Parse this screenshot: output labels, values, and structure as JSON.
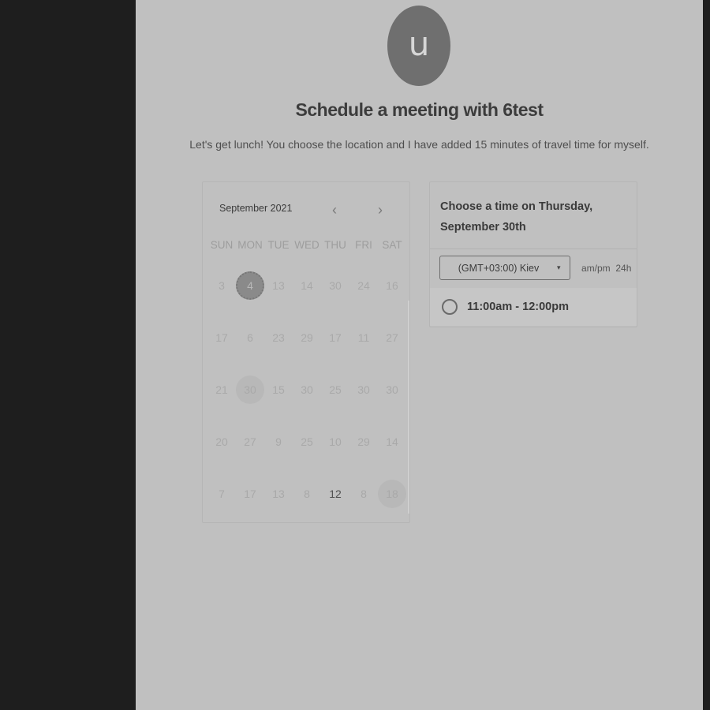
{
  "profile": {
    "avatar_letter": "u"
  },
  "page": {
    "title": "Schedule a meeting with 6test",
    "description": "Let's get lunch! You choose the location and I have added 15 minutes of travel time for myself."
  },
  "calendar": {
    "month_label": "September 2021",
    "prev_icon": "‹",
    "next_icon": "›",
    "weekdays": [
      "SUN",
      "MON",
      "TUE",
      "WED",
      "THU",
      "FRI",
      "SAT"
    ],
    "weeks": [
      [
        "3",
        "4",
        "13",
        "14",
        "30",
        "24",
        "16"
      ],
      [
        "17",
        "6",
        "23",
        "29",
        "17",
        "11",
        "27"
      ],
      [
        "21",
        "30",
        "15",
        "30",
        "25",
        "30",
        "30"
      ],
      [
        "20",
        "27",
        "9",
        "25",
        "10",
        "29",
        "14"
      ],
      [
        "7",
        "17",
        "13",
        "8",
        "12",
        "8",
        "18"
      ]
    ],
    "selected_day": "4",
    "highlighted": [
      "2-1",
      "4-6"
    ],
    "emphasized": [
      "4-4"
    ]
  },
  "timepanel": {
    "heading": "Choose a time on Thursday, September 30th",
    "timezone": "(GMT+03:00) Kiev",
    "caret_icon": "▾",
    "format_ampm": "am/pm",
    "format_24h": "24h",
    "slots": [
      "11:00am - 12:00pm"
    ]
  }
}
